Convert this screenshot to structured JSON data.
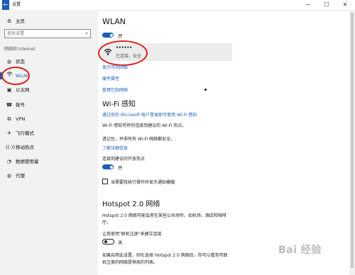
{
  "window": {
    "title": "设置",
    "back_icon": "back-arrow-icon",
    "min": "—",
    "max": "☐",
    "close": "✕"
  },
  "sidebar": {
    "home_label": "主页",
    "search_placeholder": "查找设置",
    "section_title": "网络和 Internet",
    "items": [
      {
        "label": "状态",
        "icon": "globe-icon"
      },
      {
        "label": "WLAN",
        "icon": "wifi-icon"
      },
      {
        "label": "以太网",
        "icon": "ethernet-icon"
      },
      {
        "label": "拨号",
        "icon": "phone-icon"
      },
      {
        "label": "VPN",
        "icon": "vpn-icon"
      },
      {
        "label": "飞行模式",
        "icon": "airplane-icon"
      },
      {
        "label": "移动热点",
        "icon": "hotspot-icon"
      },
      {
        "label": "数据使用量",
        "icon": "data-usage-icon"
      },
      {
        "label": "代理",
        "icon": "proxy-globe-icon"
      }
    ]
  },
  "main": {
    "title": "WLAN",
    "wlan_toggle": {
      "state": "开"
    },
    "network": {
      "name": "••••••",
      "status": "已连接，安全"
    },
    "links": [
      "显示可用网络",
      "硬件属性",
      "管理已知网络"
    ],
    "wifi_sense": {
      "title": "Wi-Fi 感知",
      "signin_link": "通过你的 Microsoft 帐户登录即可使用 Wi-Fi 感知",
      "desc1": "Wi-Fi 感知可将你连接到建议的 Wi-Fi 热点。",
      "desc2": "请记住，并非所有 Wi-Fi 网络都安全。",
      "learn_more": "了解详细信息",
      "suggested_label": "连接到建议的开放热点",
      "suggested_state": "开",
      "checkbox_label": "当需要我执行操作时显示通知横幅"
    },
    "hotspot": {
      "title": "Hotspot 2.0 网络",
      "desc_line1": "Hotspot 2.0 网络可能会用在某些公共场所，如机场、酒店和咖啡",
      "desc_line2": "厅。",
      "online_signup_label": "让我使用\"联机注册\"来建立连接",
      "toggle_state": "关",
      "bottom_line1": "如果启用此设置，则在选择 Hotspot 2.0 网络后，你可以看到可联",
      "bottom_line2": "机注册的网络提供商的列表。"
    }
  },
  "watermark": "Bai 经验",
  "colors": {
    "accent": "#1a5fb4",
    "highlight": "#e0201b",
    "sidebar_bg": "#f2f2f2"
  }
}
